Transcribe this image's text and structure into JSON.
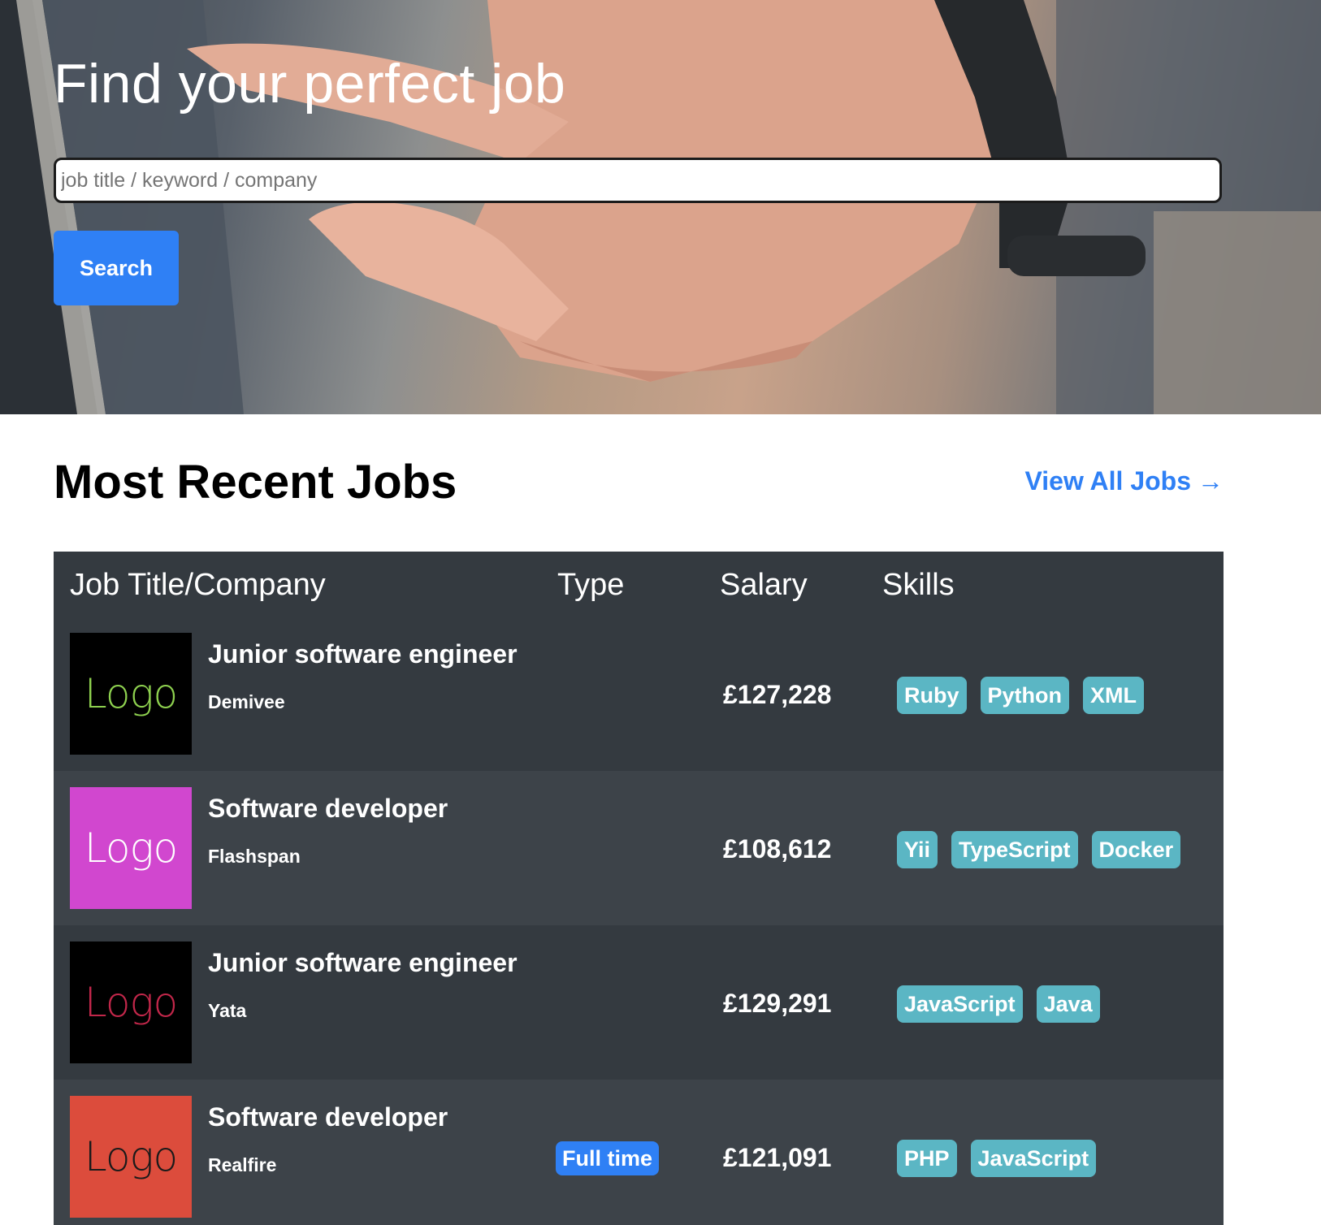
{
  "hero": {
    "title": "Find your perfect job",
    "search_placeholder": "job title / keyword / company",
    "search_value": "",
    "search_button_label": "Search"
  },
  "recent": {
    "title": "Most Recent Jobs",
    "view_all_label": "View All Jobs",
    "view_all_arrow": "→"
  },
  "table": {
    "columns": [
      "Job Title/Company",
      "Type",
      "Salary",
      "Skills"
    ],
    "rows": [
      {
        "logo_text": "Logo",
        "logo_bg": "#000000",
        "logo_color": "#8ed14f",
        "title": "Junior software engineer",
        "company": "Demivee",
        "type": "",
        "salary": "£127,228",
        "skills": [
          "Ruby",
          "Python",
          "XML"
        ]
      },
      {
        "logo_text": "Logo",
        "logo_bg": "#d147cf",
        "logo_color": "#ffffff",
        "title": "Software developer",
        "company": "Flashspan",
        "type": "",
        "salary": "£108,612",
        "skills": [
          "Yii",
          "TypeScript",
          "Docker"
        ]
      },
      {
        "logo_text": "Logo",
        "logo_bg": "#000000",
        "logo_color": "#c2274a",
        "title": "Junior software engineer",
        "company": "Yata",
        "type": "",
        "salary": "£129,291",
        "skills": [
          "JavaScript",
          "Java"
        ]
      },
      {
        "logo_text": "Logo",
        "logo_bg": "#dc4c3c",
        "logo_color": "#1a1a1a",
        "title": "Software developer",
        "company": "Realfire",
        "type": "Full time",
        "salary": "£121,091",
        "skills": [
          "PHP",
          "JavaScript"
        ]
      }
    ]
  },
  "colors": {
    "accent": "#2f80f5",
    "table_bg": "#343a40",
    "table_row_alt": "#3d4349",
    "skill_badge": "#5bb6c4"
  }
}
